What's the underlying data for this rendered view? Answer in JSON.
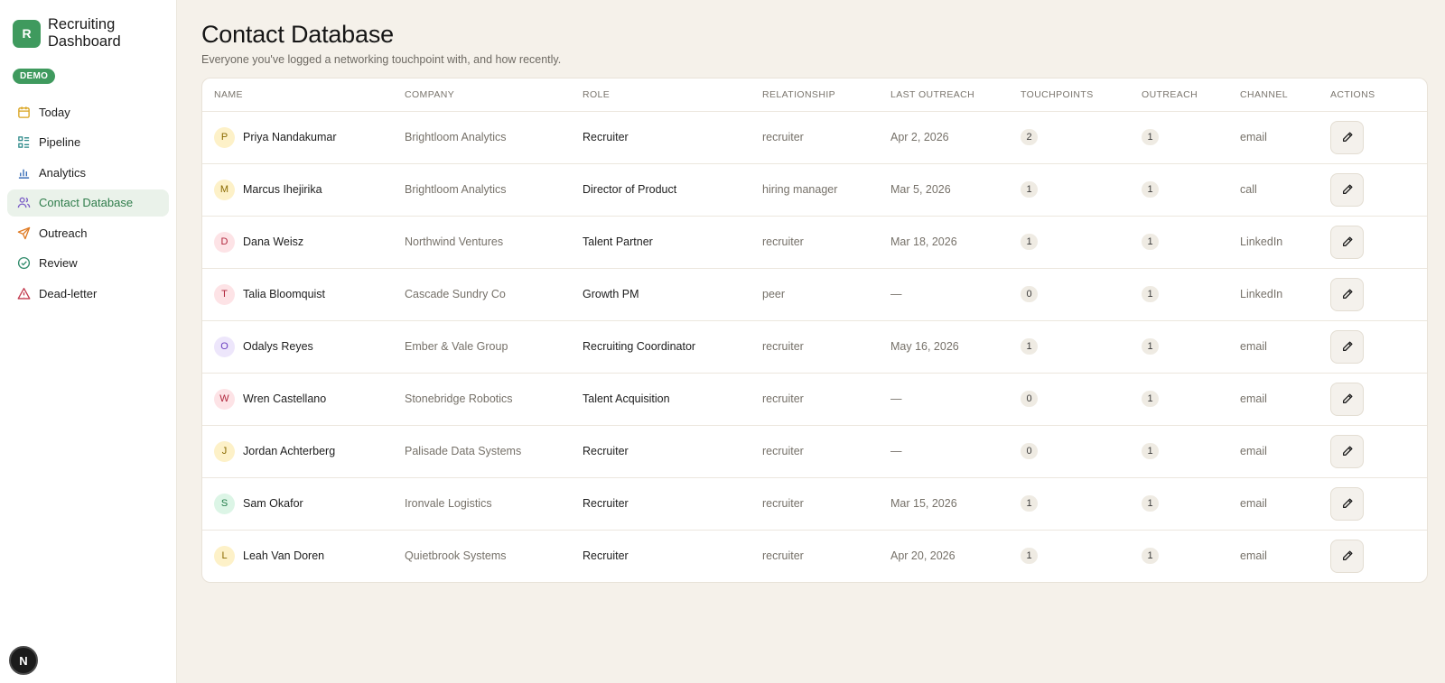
{
  "brand": {
    "logo_letter": "R",
    "title_line1": "Recruiting",
    "title_line2": "Dashboard",
    "demo_badge": "DEMO"
  },
  "nav": [
    {
      "label": "Today",
      "icon": "calendar-icon",
      "active": false
    },
    {
      "label": "Pipeline",
      "icon": "pipeline-icon",
      "active": false
    },
    {
      "label": "Analytics",
      "icon": "bar-chart-icon",
      "active": false
    },
    {
      "label": "Contact Database",
      "icon": "users-icon",
      "active": true
    },
    {
      "label": "Outreach",
      "icon": "send-icon",
      "active": false
    },
    {
      "label": "Review",
      "icon": "check-circle-icon",
      "active": false
    },
    {
      "label": "Dead-letter",
      "icon": "warning-icon",
      "active": false
    }
  ],
  "next_badge": "N",
  "page": {
    "title": "Contact Database",
    "subtitle": "Everyone you've logged a networking touchpoint with, and how recently."
  },
  "table": {
    "columns": [
      "NAME",
      "COMPANY",
      "ROLE",
      "RELATIONSHIP",
      "LAST OUTREACH",
      "TOUCHPOINTS",
      "OUTREACH",
      "CHANNEL",
      "ACTIONS"
    ],
    "rows": [
      {
        "initial": "P",
        "name": "Priya Nandakumar",
        "company": "Brightloom Analytics",
        "role": "Recruiter",
        "relationship": "recruiter",
        "last_outreach": "Apr 2, 2026",
        "touchpoints": "2",
        "outreach": "1",
        "channel": "email",
        "avatar_bg": "#fdf1c8",
        "avatar_fg": "#8a6a00"
      },
      {
        "initial": "M",
        "name": "Marcus Ihejirika",
        "company": "Brightloom Analytics",
        "role": "Director of Product",
        "relationship": "hiring manager",
        "last_outreach": "Mar 5, 2026",
        "touchpoints": "1",
        "outreach": "1",
        "channel": "call",
        "avatar_bg": "#fdf1c8",
        "avatar_fg": "#8a6a00"
      },
      {
        "initial": "D",
        "name": "Dana Weisz",
        "company": "Northwind Ventures",
        "role": "Talent Partner",
        "relationship": "recruiter",
        "last_outreach": "Mar 18, 2026",
        "touchpoints": "1",
        "outreach": "1",
        "channel": "LinkedIn",
        "avatar_bg": "#fde3e6",
        "avatar_fg": "#b0263c"
      },
      {
        "initial": "T",
        "name": "Talia Bloomquist",
        "company": "Cascade Sundry Co",
        "role": "Growth PM",
        "relationship": "peer",
        "last_outreach": "—",
        "touchpoints": "0",
        "outreach": "1",
        "channel": "LinkedIn",
        "avatar_bg": "#fde3e6",
        "avatar_fg": "#b0263c"
      },
      {
        "initial": "O",
        "name": "Odalys Reyes",
        "company": "Ember & Vale Group",
        "role": "Recruiting Coordinator",
        "relationship": "recruiter",
        "last_outreach": "May 16, 2026",
        "touchpoints": "1",
        "outreach": "1",
        "channel": "email",
        "avatar_bg": "#ede6fb",
        "avatar_fg": "#6b3fbf"
      },
      {
        "initial": "W",
        "name": "Wren Castellano",
        "company": "Stonebridge Robotics",
        "role": "Talent Acquisition",
        "relationship": "recruiter",
        "last_outreach": "—",
        "touchpoints": "0",
        "outreach": "1",
        "channel": "email",
        "avatar_bg": "#fde3e6",
        "avatar_fg": "#b0263c"
      },
      {
        "initial": "J",
        "name": "Jordan Achterberg",
        "company": "Palisade Data Systems",
        "role": "Recruiter",
        "relationship": "recruiter",
        "last_outreach": "—",
        "touchpoints": "0",
        "outreach": "1",
        "channel": "email",
        "avatar_bg": "#fdf1c8",
        "avatar_fg": "#8a6a00"
      },
      {
        "initial": "S",
        "name": "Sam Okafor",
        "company": "Ironvale Logistics",
        "role": "Recruiter",
        "relationship": "recruiter",
        "last_outreach": "Mar 15, 2026",
        "touchpoints": "1",
        "outreach": "1",
        "channel": "email",
        "avatar_bg": "#dcf5e6",
        "avatar_fg": "#1f7a47"
      },
      {
        "initial": "L",
        "name": "Leah Van Doren",
        "company": "Quietbrook Systems",
        "role": "Recruiter",
        "relationship": "recruiter",
        "last_outreach": "Apr 20, 2026",
        "touchpoints": "1",
        "outreach": "1",
        "channel": "email",
        "avatar_bg": "#fdf1c8",
        "avatar_fg": "#8a6a00"
      }
    ]
  },
  "colors": {
    "accent": "#3f9a5e",
    "active_nav_bg": "#eaf2ea",
    "active_nav_text": "#2f7d4b",
    "page_bg": "#f5f1ea"
  }
}
